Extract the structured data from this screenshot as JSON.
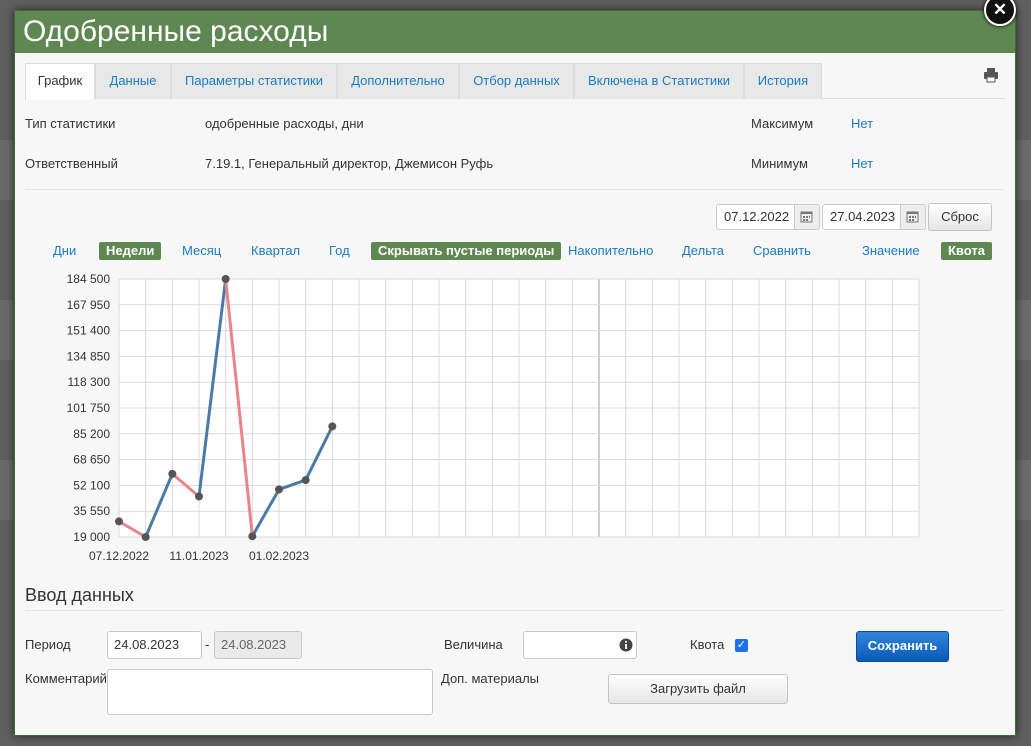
{
  "title": "Одобренные расходы",
  "close_icon": "close-icon",
  "tabs": [
    {
      "label": "График",
      "active": true
    },
    {
      "label": "Данные"
    },
    {
      "label": "Параметры статистики"
    },
    {
      "label": "Дополнительно"
    },
    {
      "label": "Отбор данных"
    },
    {
      "label": "Включена в Статистики"
    },
    {
      "label": "История"
    }
  ],
  "info": {
    "type_label": "Тип статистики",
    "type_value": "одобренные расходы, дни",
    "owner_label": "Ответственный",
    "owner_value": "7.19.1, Генеральный директор, Джемисон Руфь",
    "max_label": "Максимум",
    "max_value": "Нет",
    "min_label": "Минимум",
    "min_value": "Нет"
  },
  "range": {
    "from": "07.12.2022",
    "to": "27.04.2023",
    "reset": "Сброс"
  },
  "modes": [
    {
      "label": "Дни",
      "on": false
    },
    {
      "label": "Недели",
      "on": true
    },
    {
      "label": "Месяц",
      "on": false
    },
    {
      "label": "Квартал",
      "on": false
    },
    {
      "label": "Год",
      "on": false
    },
    {
      "label": "Скрывать пустые периоды",
      "on": true
    },
    {
      "label": "Накопительно",
      "on": false
    },
    {
      "label": "Дельта",
      "on": false
    },
    {
      "label": "Сравнить",
      "on": false
    },
    {
      "label": "Значение",
      "on": false
    },
    {
      "label": "Квота",
      "on": true
    }
  ],
  "chart_data": {
    "type": "line",
    "ylim": [
      19000,
      184500
    ],
    "y_ticks": [
      "184 500",
      "167 950",
      "151 400",
      "134 850",
      "118 300",
      "101 750",
      "85 200",
      "68 650",
      "52 100",
      "35 550",
      "19 000"
    ],
    "x_tick_labels": [
      {
        "index": 0,
        "label": "07.12.2022"
      },
      {
        "index": 3,
        "label": "11.01.2023"
      },
      {
        "index": 6,
        "label": "01.02.2023"
      }
    ],
    "points": [
      29000,
      19000,
      59500,
      45000,
      184500,
      19500,
      49500,
      55500,
      90000
    ],
    "up_color": "#4a7ba8",
    "down_color": "#e8858a",
    "grid": true
  },
  "entry": {
    "section_title": "Ввод данных",
    "period_label": "Период",
    "period_from": "24.08.2023",
    "period_sep": "-",
    "period_to": "24.08.2023",
    "comment_label": "Комментарий",
    "value_label": "Величина",
    "value": "",
    "materials_label": "Доп. материалы",
    "upload_label": "Загрузить файл",
    "quota_label": "Квота",
    "quota_checked": true,
    "save_label": "Сохранить"
  }
}
